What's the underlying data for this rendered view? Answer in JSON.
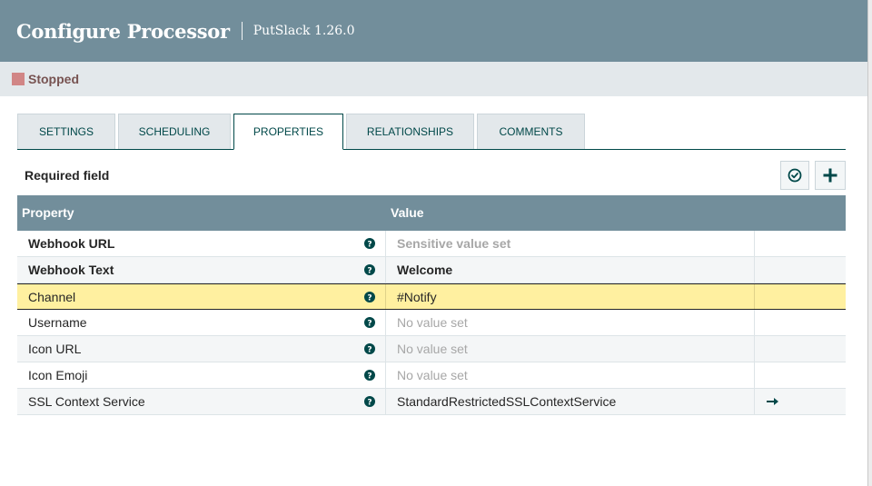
{
  "dialog": {
    "title": "Configure Processor",
    "subtitle": "PutSlack 1.26.0"
  },
  "status": {
    "label": "Stopped",
    "color": "#d18686"
  },
  "tabs": [
    {
      "label": "SETTINGS"
    },
    {
      "label": "SCHEDULING"
    },
    {
      "label": "PROPERTIES",
      "active": true
    },
    {
      "label": "RELATIONSHIPS"
    },
    {
      "label": "COMMENTS"
    }
  ],
  "properties_panel": {
    "required_label": "Required field",
    "verify_icon": "check-circle-icon",
    "add_icon": "plus-icon"
  },
  "table": {
    "headers": {
      "property": "Property",
      "value": "Value"
    },
    "rows": [
      {
        "name": "Webhook URL",
        "value": "Sensitive value set"
      },
      {
        "name": "Webhook Text",
        "value": "Welcome"
      },
      {
        "name": "Channel",
        "value": "#Notify"
      },
      {
        "name": "Username",
        "value": "No value set"
      },
      {
        "name": "Icon URL",
        "value": "No value set"
      },
      {
        "name": "Icon Emoji",
        "value": "No value set"
      },
      {
        "name": "SSL Context Service",
        "value": "StandardRestrictedSSLContextService",
        "action_icon": "arrow-right-icon"
      }
    ]
  },
  "colors": {
    "header_bg": "#728e9b",
    "accent": "#004849",
    "selected_row": "#fff0a0"
  }
}
